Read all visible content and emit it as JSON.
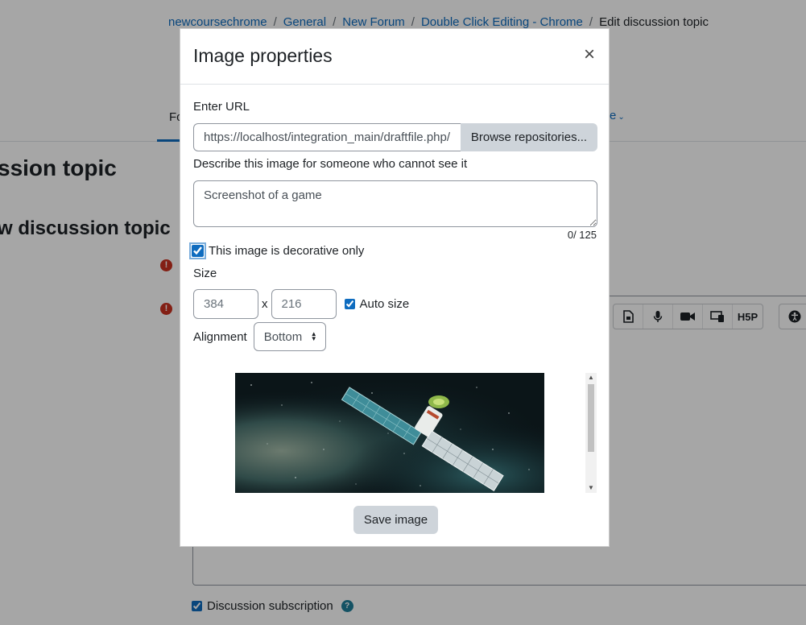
{
  "breadcrumb": {
    "items": [
      "newcoursechrome",
      "General",
      "New Forum",
      "Double Click Editing - Chrome"
    ],
    "current": "Edit discussion topic"
  },
  "background": {
    "tab_active": "Fo",
    "tab_more": "e",
    "heading1": "ssion topic",
    "heading2": "w discussion topic",
    "subscription_label": "Discussion subscription",
    "toolbar_h5p_label": "H5P"
  },
  "modal": {
    "title": "Image properties",
    "close_glyph": "×",
    "url_label": "Enter URL",
    "url_value": "https://localhost/integration_main/draftfile.php/",
    "browse_label": "Browse repositories...",
    "alt_label": "Describe this image for someone who cannot see it",
    "alt_value": "Screenshot of a game",
    "alt_counter": "0/ 125",
    "decorative_label": "This image is decorative only",
    "decorative_checked": true,
    "size_label": "Size",
    "width_value": "384",
    "height_value": "216",
    "size_separator": "x",
    "auto_size_label": "Auto size",
    "auto_size_checked": true,
    "alignment_label": "Alignment",
    "alignment_value": "Bottom",
    "save_label": "Save image"
  },
  "colors": {
    "link": "#0f6cbf",
    "required": "#ca3120",
    "button_secondary": "#ced4da"
  }
}
